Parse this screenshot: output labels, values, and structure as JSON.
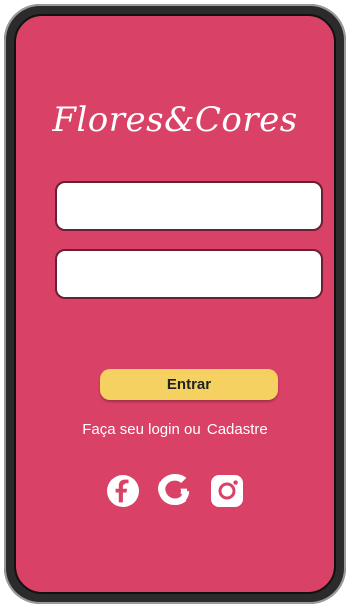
{
  "app": {
    "title": "Flores&Cores"
  },
  "login": {
    "username_value": "",
    "password_value": "",
    "username_placeholder": "",
    "password_placeholder": "",
    "button_label": "Entrar"
  },
  "footer": {
    "login_text": "Faça seu login ou",
    "signup_text": "Cadastre"
  },
  "social": {
    "icons": [
      "facebook-icon",
      "google-icon",
      "instagram-icon"
    ]
  },
  "colors": {
    "background": "#d94166",
    "button": "#f4d160",
    "text": "#ffffff"
  }
}
